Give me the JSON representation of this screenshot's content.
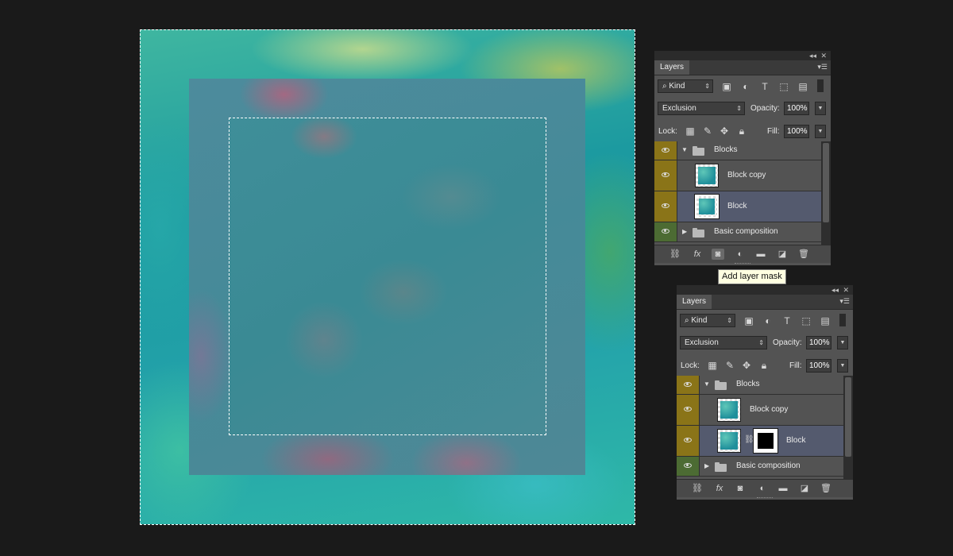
{
  "canvas": {
    "description_colors": {
      "base": "#2aa5a5",
      "block_outer": "#4a8a98",
      "block_inner": "#3e8c96"
    }
  },
  "tooltip": {
    "text": "Add layer mask"
  },
  "panels": [
    {
      "tab": "Layers",
      "filter": {
        "kind_label": "Kind"
      },
      "blend_mode": "Exclusion",
      "opacity_label": "Opacity:",
      "opacity_value": "100%",
      "lock_label": "Lock:",
      "fill_label": "Fill:",
      "fill_value": "100%",
      "layers": [
        {
          "name": "Blocks",
          "type": "group",
          "expanded": true
        },
        {
          "name": "Block copy",
          "type": "layer"
        },
        {
          "name": "Block",
          "type": "layer",
          "selected": true
        },
        {
          "name": "Basic composition",
          "type": "group",
          "expanded": false
        }
      ]
    },
    {
      "tab": "Layers",
      "filter": {
        "kind_label": "Kind"
      },
      "blend_mode": "Exclusion",
      "opacity_label": "Opacity:",
      "opacity_value": "100%",
      "lock_label": "Lock:",
      "fill_label": "Fill:",
      "fill_value": "100%",
      "layers": [
        {
          "name": "Blocks",
          "type": "group",
          "expanded": true
        },
        {
          "name": "Block copy",
          "type": "layer"
        },
        {
          "name": "Block",
          "type": "layer",
          "selected": true,
          "has_mask": true
        },
        {
          "name": "Basic composition",
          "type": "group",
          "expanded": false
        }
      ]
    }
  ],
  "footer_icons": [
    "link-layers-icon",
    "fx-icon",
    "add-mask-icon",
    "adjustment-icon",
    "new-group-icon",
    "new-layer-icon",
    "delete-icon"
  ],
  "colors": {
    "eye_gold": "#8a7418",
    "eye_green": "#4c6b33",
    "selected_row": "#545a6e"
  }
}
